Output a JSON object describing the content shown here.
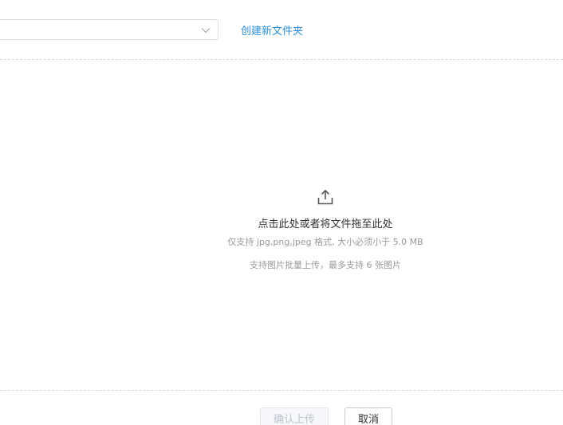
{
  "folder_select": {
    "selected_value": "",
    "chevron_icon": "chevron-down-icon"
  },
  "create_folder_link": "创建新文件夹",
  "upload": {
    "icon": "upload-icon",
    "title": "点击此处或者将文件拖至此处",
    "hint_formats": "仅支持 jpg,png,jpeg 格式, 大小必须小于 5.0 MB",
    "hint_batch": "支持图片批量上传，最多支持 6 张图片"
  },
  "footer": {
    "confirm_label": "确认上传",
    "cancel_label": "取消"
  },
  "colors": {
    "link": "#2b8fd6",
    "disabled_text": "#c0c4cc",
    "divider": "#d4d7de"
  }
}
